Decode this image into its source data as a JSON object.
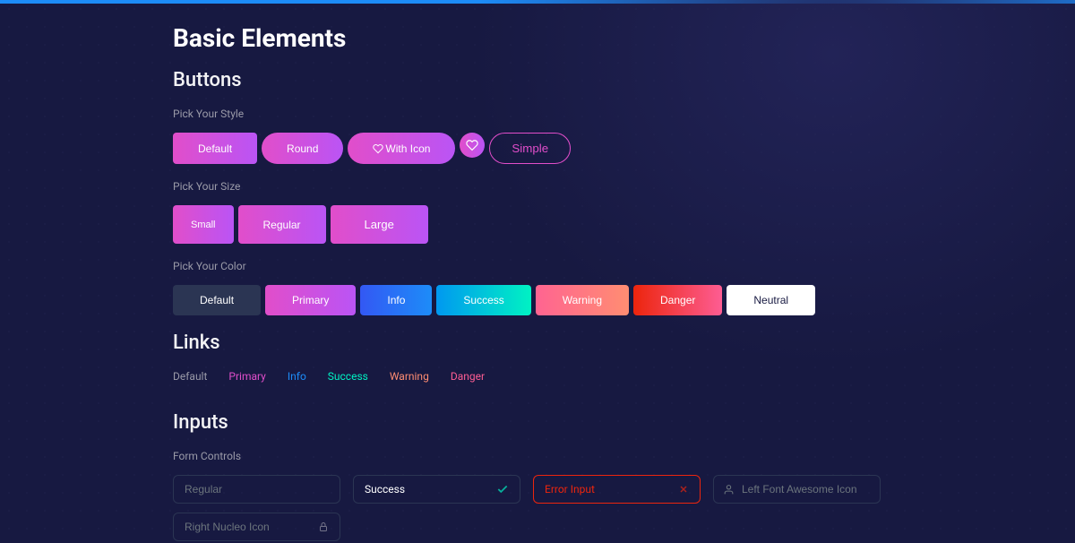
{
  "page": {
    "title": "Basic Elements"
  },
  "buttons": {
    "section": "Buttons",
    "style_label": "Pick Your Style",
    "style": {
      "default": "Default",
      "round": "Round",
      "with_icon": "With Icon",
      "simple": "Simple"
    },
    "size_label": "Pick Your Size",
    "size": {
      "small": "Small",
      "regular": "Regular",
      "large": "Large"
    },
    "color_label": "Pick Your Color",
    "color": {
      "default": "Default",
      "primary": "Primary",
      "info": "Info",
      "success": "Success",
      "warning": "Warning",
      "danger": "Danger",
      "neutral": "Neutral"
    }
  },
  "links": {
    "section": "Links",
    "default": "Default",
    "primary": "Primary",
    "info": "Info",
    "success": "Success",
    "warning": "Warning",
    "danger": "Danger"
  },
  "inputs": {
    "section": "Inputs",
    "label": "Form Controls",
    "regular_placeholder": "Regular",
    "success_value": "Success",
    "error_value": "Error Input",
    "lefticon_placeholder": "Left Font Awesome Icon",
    "rightnucleo_placeholder": "Right Nucleo Icon"
  }
}
